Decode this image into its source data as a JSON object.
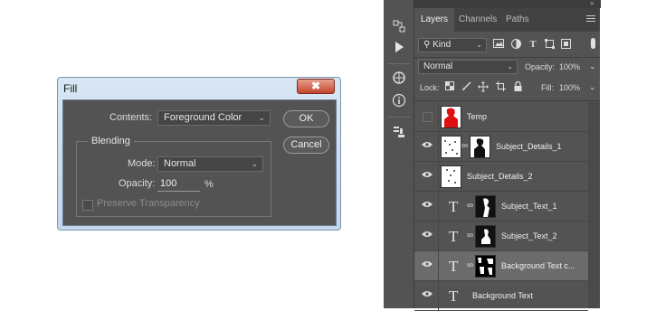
{
  "dialog": {
    "title": "Fill",
    "close_label": "✖",
    "contents_label": "Contents:",
    "contents_value": "Foreground Color",
    "blending_label": "Blending",
    "mode_label": "Mode:",
    "mode_value": "Normal",
    "opacity_label": "Opacity:",
    "opacity_value": "100",
    "opacity_unit": "%",
    "preserve_label": "Preserve Transparency",
    "ok_label": "OK",
    "cancel_label": "Cancel"
  },
  "panel": {
    "collapse_left": "«",
    "collapse_right": "»",
    "tabs": [
      "Layers",
      "Channels",
      "Paths"
    ],
    "kind_label": "Kind",
    "blend_mode": "Normal",
    "opacity_label": "Opacity:",
    "opacity_value": "100%",
    "lock_label": "Lock:",
    "fill_label": "Fill:",
    "fill_value": "100%",
    "layers": [
      {
        "name": "Temp",
        "visible": false,
        "type": "pixel-red"
      },
      {
        "name": "Subject_Details_1",
        "visible": true,
        "type": "pixel-masked"
      },
      {
        "name": "Subject_Details_2",
        "visible": true,
        "type": "pixel"
      },
      {
        "name": "Subject_Text_1",
        "visible": true,
        "type": "text-masked"
      },
      {
        "name": "Subject_Text_2",
        "visible": true,
        "type": "text-masked"
      },
      {
        "name": "Background Text c...",
        "visible": true,
        "type": "text-masked",
        "selected": true
      },
      {
        "name": "Background Text",
        "visible": true,
        "type": "text"
      }
    ]
  },
  "colors": {
    "panel_bg": "#535353",
    "selected_layer": "#6b6b6b",
    "dialog_frame": "#c3d6ec",
    "temp_thumb": "#e01010"
  }
}
